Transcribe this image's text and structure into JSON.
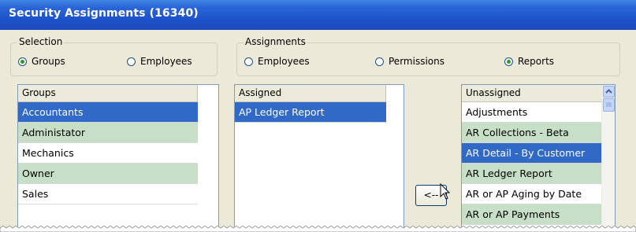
{
  "window": {
    "title": "Security Assignments (16340)"
  },
  "selection": {
    "label": "Selection",
    "options": [
      {
        "label": "Groups",
        "checked": true
      },
      {
        "label": "Employees",
        "checked": false
      }
    ]
  },
  "assignments": {
    "label": "Assignments",
    "options": [
      {
        "label": "Employees",
        "checked": false
      },
      {
        "label": "Permissions",
        "checked": false
      },
      {
        "label": "Reports",
        "checked": true
      }
    ]
  },
  "groups_list": {
    "header": "Groups",
    "items": [
      {
        "label": "Accountants",
        "state": "selected"
      },
      {
        "label": "Administator",
        "state": "green"
      },
      {
        "label": "Mechanics",
        "state": "white"
      },
      {
        "label": "Owner",
        "state": "green"
      },
      {
        "label": "Sales",
        "state": "white"
      }
    ]
  },
  "assigned_list": {
    "header": "Assigned",
    "items": [
      {
        "label": "AP Ledger Report",
        "state": "selected"
      }
    ]
  },
  "unassigned_list": {
    "header": "Unassigned",
    "items": [
      {
        "label": "Adjustments",
        "state": "white"
      },
      {
        "label": "AR Collections - Beta",
        "state": "green"
      },
      {
        "label": "AR Detail - By Customer",
        "state": "selected"
      },
      {
        "label": "AR Ledger Report",
        "state": "green"
      },
      {
        "label": "AR or AP Aging by Date",
        "state": "white"
      },
      {
        "label": "AR or AP Payments",
        "state": "green"
      }
    ]
  },
  "move_button": {
    "label": "<--"
  },
  "colors": {
    "title_bar": "#1c4fc7",
    "selected_row": "#3169c6",
    "green_row": "#c6dfc6",
    "dialog_bg": "#ece9d8"
  }
}
